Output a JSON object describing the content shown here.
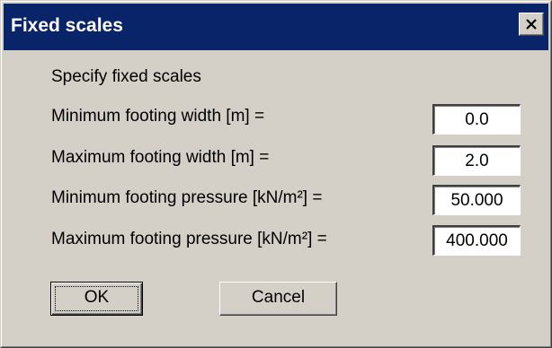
{
  "window": {
    "title": "Fixed scales",
    "close_icon": "close-icon"
  },
  "heading": "Specify fixed scales",
  "fields": [
    {
      "label": "Minimum footing width [m] =",
      "value": "0.0"
    },
    {
      "label": "Maximum footing width [m] =",
      "value": "2.0"
    },
    {
      "label": "Minimum footing pressure  [kN/m²] =",
      "value": "50.000"
    },
    {
      "label": "Maximum footing pressure  [kN/m²] =",
      "value": "400.000"
    }
  ],
  "buttons": {
    "ok": "OK",
    "cancel": "Cancel"
  },
  "colors": {
    "titlebar": "#0a246a",
    "dialog_bg": "#d4d0c8"
  }
}
